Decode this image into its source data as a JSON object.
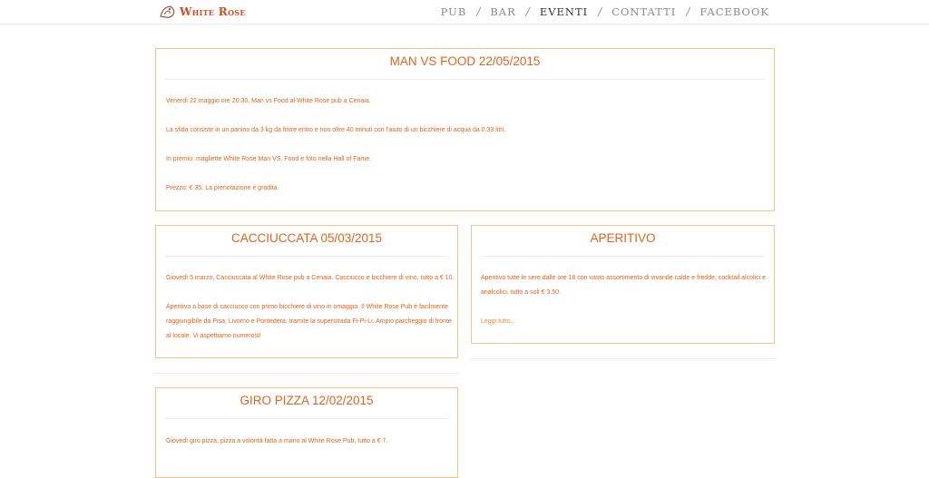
{
  "brand": {
    "name": "White Rose"
  },
  "nav": {
    "items": [
      "PUB",
      "BAR",
      "EVENTI",
      "CONTATTI",
      "FACEBOOK"
    ],
    "separator": "/",
    "active": "EVENTI"
  },
  "colors": {
    "accent": "#e0641e",
    "border": "#f0c48c",
    "nav": "#8a8a8a",
    "nav_active": "#333333"
  },
  "events": [
    {
      "title": "MAN VS FOOD 22/05/2015",
      "paragraphs": [
        "Venerdì 22 maggio ore 20:30, Man vs Food al White Rose pub a Cenaia.",
        "La sfida consiste in un panino da 3 kg da finire entro e non oltre 40 minuti con l'aiuto di un bicchiere di acqua da 0.33 litri.",
        "In premio: magliette White Rose Man VS. Food e foto nella Hall of Fame.",
        "Prezzo: € 35. La prenotazione è gradita."
      ]
    },
    {
      "title": "CACCIUCCATA 05/03/2015",
      "paragraphs": [
        "Giovedì 5 marzo, Cacciuccata al White Rose pub a Cenaia. Cacciucco e bicchiere di vino, tutto a € 10.",
        "Aperitivo a base di cacciucco con primo bicchiere di vino in omaggio. Il White Rose Pub è facilmente",
        "raggiungibile da Pisa, Livorno e Pontedera, tramite la superstrada Fi-Pi-Li. Ampio parcheggio di fronte",
        "al locale. Vi aspettiamo numerosi!"
      ]
    },
    {
      "title": "APERITIVO",
      "paragraphs": [
        "Aperitivo tutte le sere dalle ore 18 con vasto assortimento di vivande calde e fredde, cocktail alcolici e",
        "analcolici, tutto a soli € 3.50."
      ],
      "read_more": "Leggi tutto..."
    },
    {
      "title": "GIRO PIZZA 12/02/2015",
      "paragraphs": [
        "Giovedì giro pizza, pizza a volontà fatta a mano al White Rose Pub, tutto a € 7."
      ]
    }
  ]
}
